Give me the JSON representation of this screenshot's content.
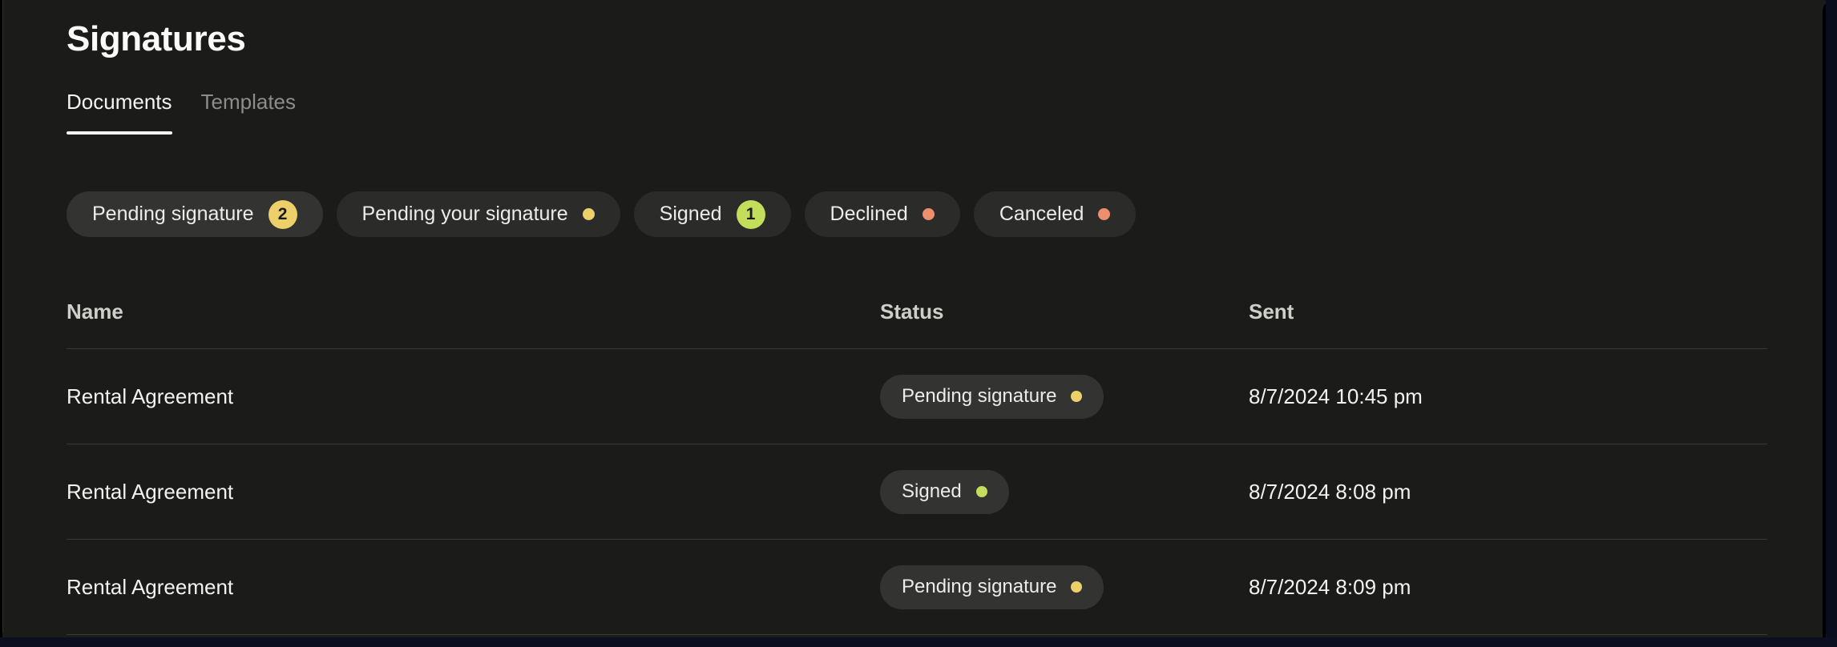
{
  "window": {
    "background": "#1b1b19",
    "bottom_strip_color": "#0b0f20"
  },
  "header": {
    "title": "Signatures"
  },
  "tabs": [
    {
      "label": "Documents",
      "active": true
    },
    {
      "label": "Templates",
      "active": false
    }
  ],
  "filters": [
    {
      "label": "Pending signature",
      "count": "2",
      "badge_color": "#eed06a",
      "badge_type": "count",
      "selected": true
    },
    {
      "label": "Pending your signature",
      "count": "",
      "badge_color": "#eed06a",
      "badge_type": "dot",
      "selected": false
    },
    {
      "label": "Signed",
      "count": "1",
      "badge_color": "#c2de5a",
      "badge_type": "count",
      "selected": false
    },
    {
      "label": "Declined",
      "count": "",
      "badge_color": "#ec8f6d",
      "badge_type": "dot",
      "selected": false
    },
    {
      "label": "Canceled",
      "count": "",
      "badge_color": "#ec8f6d",
      "badge_type": "dot",
      "selected": false
    }
  ],
  "table": {
    "columns": [
      "Name",
      "Status",
      "Sent"
    ],
    "rows": [
      {
        "name": "Rental Agreement",
        "status": "Pending signature",
        "status_color": "#eed06a",
        "sent": "8/7/2024 10:45 pm"
      },
      {
        "name": "Rental Agreement",
        "status": "Signed",
        "status_color": "#c2de5a",
        "sent": "8/7/2024 8:08 pm"
      },
      {
        "name": "Rental Agreement",
        "status": "Pending signature",
        "status_color": "#eed06a",
        "sent": "8/7/2024 8:09 pm"
      }
    ]
  }
}
